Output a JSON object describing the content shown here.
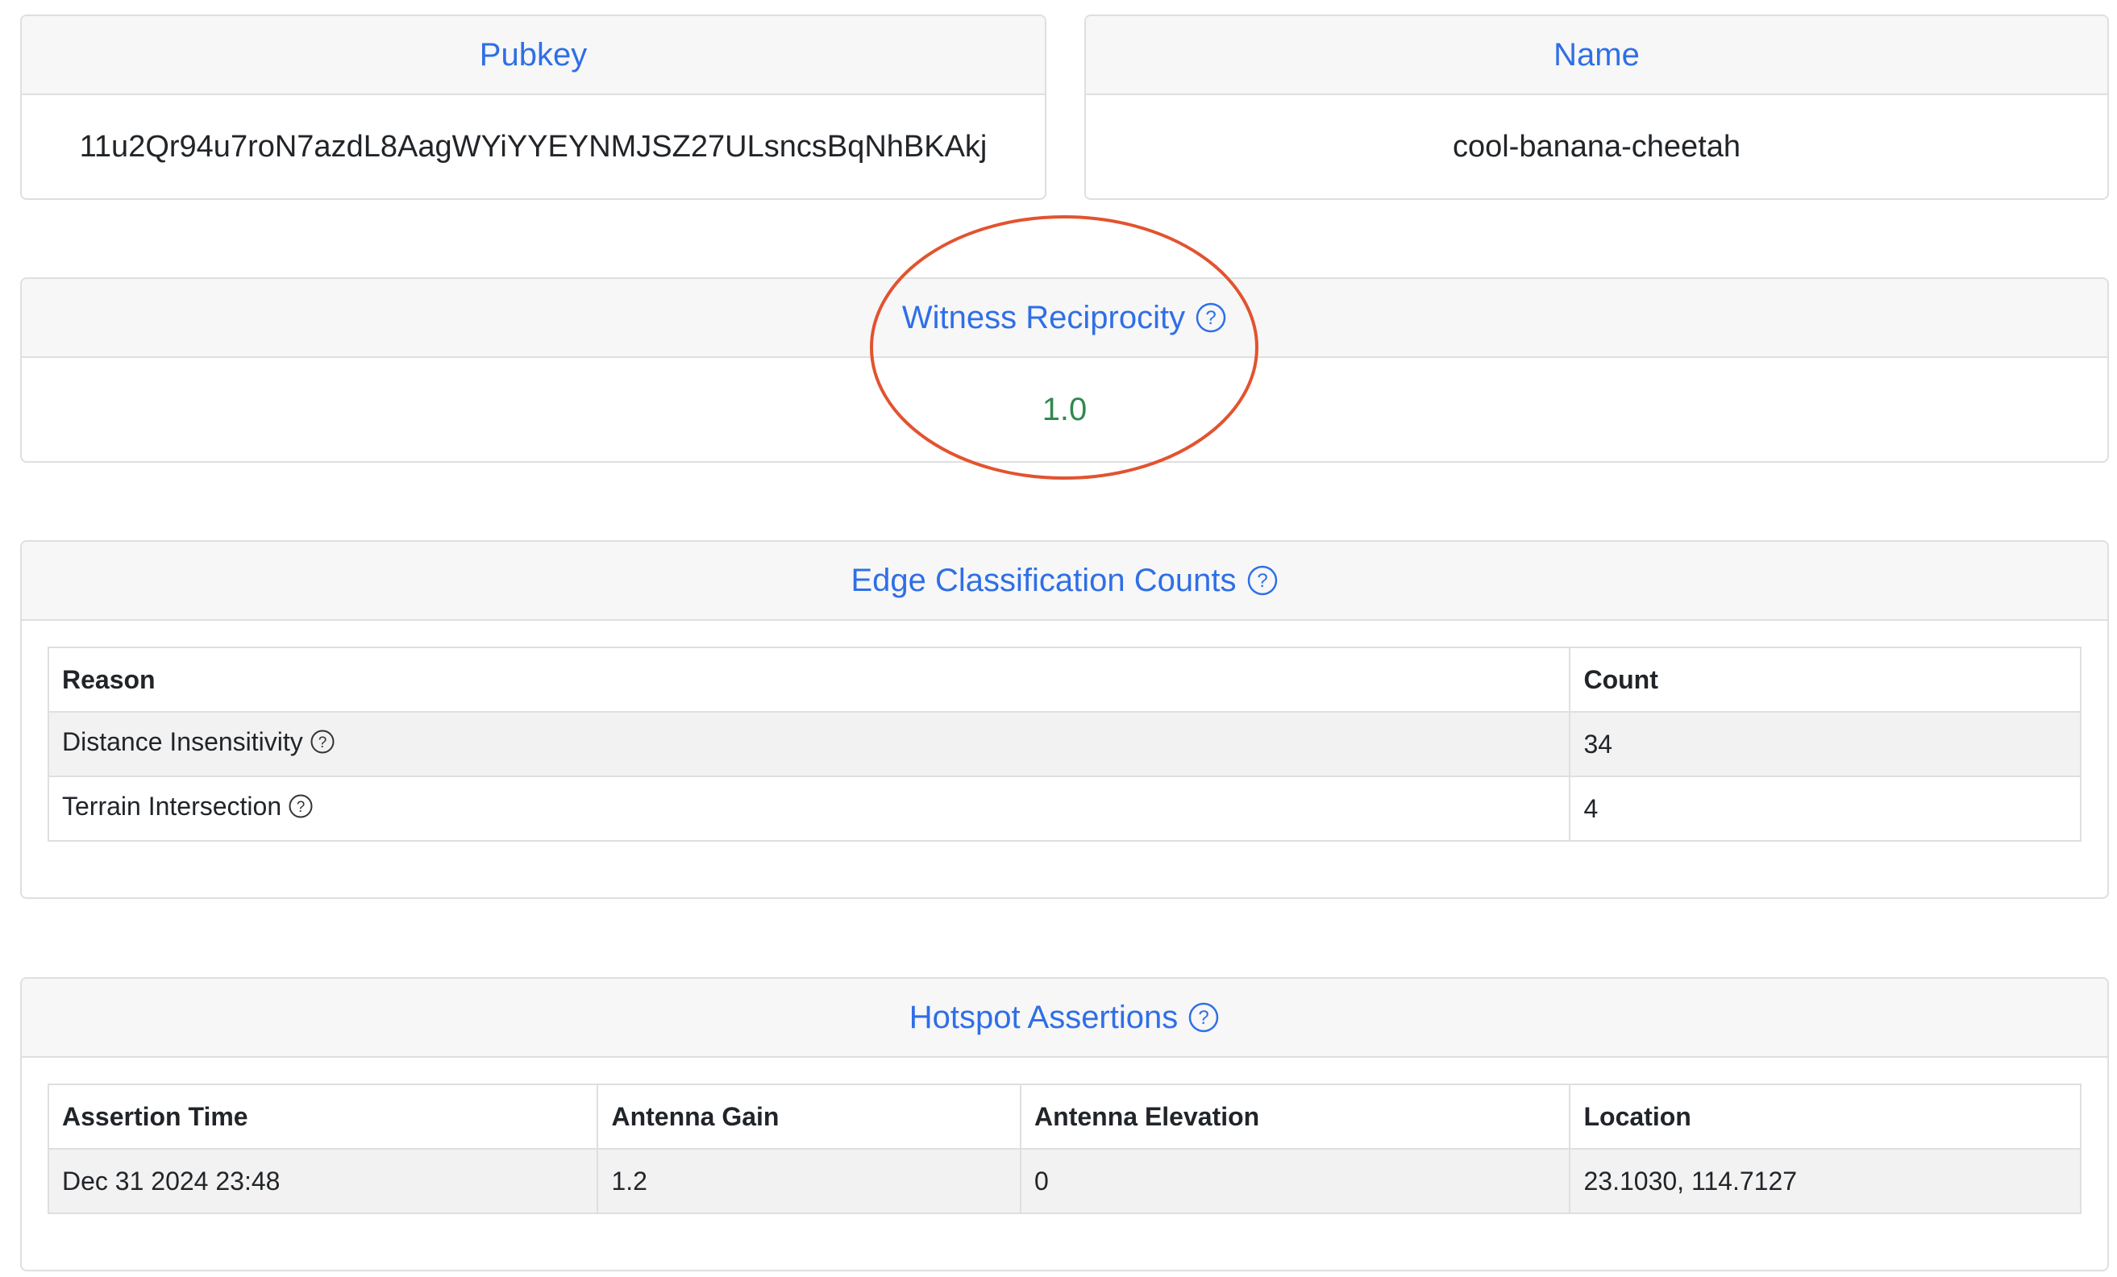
{
  "pubkey_card": {
    "title": "Pubkey",
    "value": "11u2Qr94u7roN7azdL8AagWYiYYEYNMJSZ27ULsncsBqNhBKAkj"
  },
  "name_card": {
    "title": "Name",
    "value": "cool-banana-cheetah"
  },
  "reciprocity_card": {
    "title": "Witness Reciprocity",
    "value": "1.0",
    "value_color": "#2f8a4f"
  },
  "edge_card": {
    "title": "Edge Classification Counts",
    "columns": [
      "Reason",
      "Count"
    ],
    "rows": [
      {
        "reason": "Distance Insensitivity",
        "count": "34"
      },
      {
        "reason": "Terrain Intersection",
        "count": "4"
      }
    ]
  },
  "assertions_card": {
    "title": "Hotspot Assertions",
    "columns": [
      "Assertion Time",
      "Antenna Gain",
      "Antenna Elevation",
      "Location"
    ],
    "rows": [
      {
        "time": "Dec 31 2024 23:48",
        "gain": "1.2",
        "elevation": "0",
        "location": "23.1030, 114.7127"
      }
    ]
  },
  "colors": {
    "accent": "#2f6fe6",
    "highlight_ellipse": "#e2532f",
    "border": "#dfdfdf"
  },
  "icons": [
    "help-circle-icon"
  ]
}
